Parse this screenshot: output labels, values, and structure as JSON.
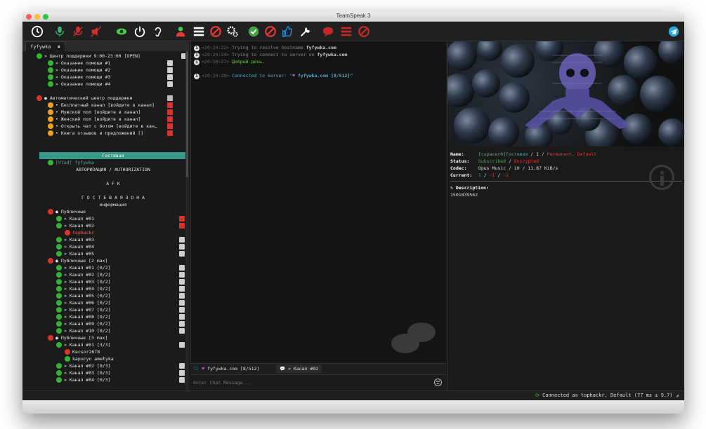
{
  "window": {
    "title": "TeamSpeak 3"
  },
  "toolbar": {
    "buttons": [
      {
        "name": "clock-icon",
        "color": "#ffffff"
      },
      {
        "name": "mic-icon",
        "color": "#3cb371"
      },
      {
        "name": "mic-muted-icon",
        "color": "#d32f2f"
      },
      {
        "name": "speaker-muted-icon",
        "color": "#d32f2f"
      },
      {
        "name": "eye-icon",
        "color": "#44cc44"
      },
      {
        "name": "power-icon",
        "color": "#ffffff"
      },
      {
        "name": "ear-icon",
        "color": "#ffffff"
      },
      {
        "name": "users-icon",
        "color": "#44cc44"
      },
      {
        "name": "server-list-icon",
        "color": "#ffffff"
      },
      {
        "name": "forbidden-icon",
        "color": "#e53935"
      },
      {
        "name": "gear-icon",
        "color": "#ffffff"
      },
      {
        "name": "check-icon",
        "color": "#43a047"
      },
      {
        "name": "forbidden-icon",
        "color": "#e53935"
      },
      {
        "name": "thumbs-up-icon",
        "color": "#1e88e5"
      },
      {
        "name": "wrench-icon",
        "color": "#ffffff"
      },
      {
        "name": "speech-bubble-icon",
        "color": "#c62828"
      },
      {
        "name": "server-list-icon",
        "color": "#c62828"
      },
      {
        "name": "forbidden-icon",
        "color": "#c62828"
      }
    ],
    "telegram_icon": "telegram-icon"
  },
  "server_tab": {
    "label": "fyfywka",
    "close": "✖"
  },
  "tree": {
    "sections": [
      {
        "type": "channel",
        "label": "» Центр поддержки 9:00-23:00 [OPEN]",
        "level": 0,
        "icon": "green"
      },
      {
        "type": "channel",
        "label": "» Оказание помощи #1",
        "level": 1,
        "icon": "green"
      },
      {
        "type": "channel",
        "label": "» Оказание помощи #2",
        "level": 1,
        "icon": "green"
      },
      {
        "type": "channel",
        "label": "» Оказание помощи #3",
        "level": 1,
        "icon": "green"
      },
      {
        "type": "channel",
        "label": "» Оказание помощи #4",
        "level": 1,
        "icon": "green"
      },
      {
        "type": "spacer"
      },
      {
        "type": "channel",
        "label": "● Автоматический центр поддержки",
        "level": 0,
        "icon": "red"
      },
      {
        "type": "channel",
        "label": "• Бесплатный канал [войдите в канал]",
        "level": 1,
        "icon": "orange"
      },
      {
        "type": "channel",
        "label": "• Мужской пол [войдите в канал]",
        "level": 1,
        "icon": "orange"
      },
      {
        "type": "channel",
        "label": "• Женский пол [войдите в канал]",
        "level": 1,
        "icon": "orange"
      },
      {
        "type": "channel",
        "label": "• Открыть чат с ботом [войдите в кан…",
        "level": 1,
        "icon": "orange"
      },
      {
        "type": "channel",
        "label": "•  Книга отзывов и предложений []",
        "level": 1,
        "icon": "orange"
      }
    ],
    "guest_channel": "Гостевая",
    "guest_user": "[Vlad] fyfywka",
    "auth_label": "АВТОРИЗАЦИЯ / AUTHORIZATION",
    "afk_label": "A F K",
    "guest_zone": "Г О С Т Е В А Я   З О Н А",
    "info_label": "информация",
    "public_1": "● Публичные",
    "public_channels": [
      "» Канал #01",
      "» Канал #02",
      "» Канал #03",
      "» Канал #04",
      "» Канал #05"
    ],
    "tophackr": "tophackr",
    "public_2": "● Публичные [2 max]",
    "public_2_channels": [
      "» Канал #01 [0/2]",
      "» Канал #02 [0/2]",
      "» Канал #03 [0/2]",
      "» Канал #04 [0/2]",
      "» Канал #05 [0/2]",
      "» Канал #06 [0/2]",
      "» Канал #07 [0/2]",
      "» Канал #08 [0/2]",
      "» Канал #09 [0/2]",
      "» Канал #10 [0/2]"
    ],
    "public_3": "● Публичные [3 max]",
    "public_3_channel_1": "» Канал #01 [3/3]",
    "user_1": "Kacsor2678",
    "user_2": "kapucyn amełyka",
    "public_3_channels": [
      "» Канал #02 [0/3]",
      "» Канал #03 [0/3]",
      "» Канал #04 [0/3]"
    ]
  },
  "chat": {
    "lines": [
      {
        "time": "<20:20:22>",
        "text": "Trying to resolve hostname ",
        "bold": "fyfywka.com",
        "color": "#888888"
      },
      {
        "time": "<20:20:24>",
        "text": "Trying to connect to server on ",
        "bold": "fyfywka.com",
        "color": "#888888"
      },
      {
        "time": "<20:20:27>",
        "text": "Добрый день.",
        "bold": "",
        "color": "#6fbf4a"
      },
      {
        "time": "<20:20:28>",
        "text": "Connected to Server: \"",
        "bold": "fyfywka.com [8/512]\"",
        "color": "#5aa9c8"
      }
    ],
    "tabs": [
      {
        "label": "fyfywka.com [8/512]"
      },
      {
        "label": "» Канал #02"
      }
    ],
    "input_placeholder": "Enter Chat Message...",
    "emoji_icon": "smiley-icon"
  },
  "info_panel": {
    "name_label": "Name:",
    "name_value": "[cspacer0]Гостевая",
    "name_sep": " / 1 / ",
    "name_tags": "Permanent, Default",
    "status_label": "Status:",
    "status_subscribed": "Subscribed",
    "status_sep": " / ",
    "status_encrypted": "Encrypted",
    "codec_label": "Codec:",
    "codec_value": "Opus Music / 10 / 11.87 KiB/s",
    "current_label": "Current:",
    "current_value_1": "1",
    "current_sep": " / ",
    "current_value_2": "-1",
    "current_value_3": "-1",
    "description_label": "Description:",
    "description_value": "1501839562"
  },
  "statusbar": {
    "text": "Connected as tophackr, Default (77 ms ± 9.7)"
  },
  "colors": {
    "green_icon": "#34b233",
    "red_icon": "#d9342b",
    "orange_icon": "#f0a020",
    "guest_highlight": "#3a9a8a",
    "error_red": "#e53935",
    "subscribed_green": "#3ab54a",
    "name_teal": "#5fa39a"
  }
}
